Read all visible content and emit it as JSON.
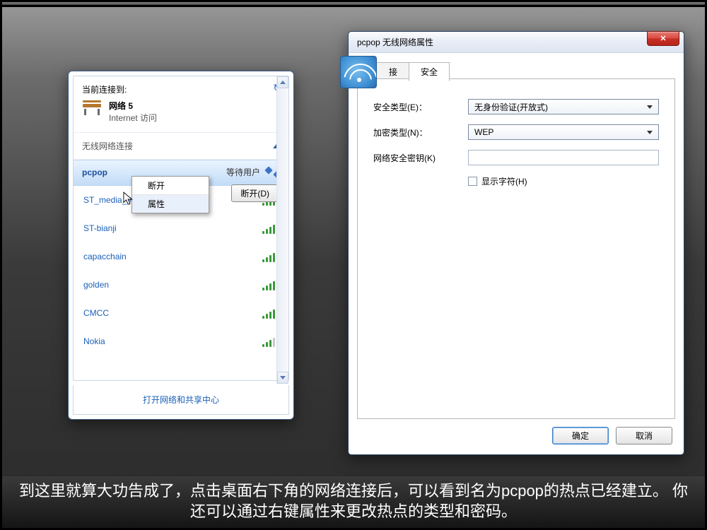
{
  "flyout": {
    "header_label": "当前连接到:",
    "current_network_name": "网络  5",
    "current_network_sub": "Internet 访问",
    "section_label": "无线网络连接",
    "connected": {
      "ssid": "pcpop",
      "status_suffix": "等待用户",
      "disconnect_btn": "断开(D)"
    },
    "context_menu": {
      "item_disconnect": "断开",
      "item_properties": "属性"
    },
    "networks": [
      {
        "ssid": "ST_media_9F",
        "bars": 5
      },
      {
        "ssid": "ST-bianji",
        "bars": 4
      },
      {
        "ssid": "capacchain",
        "bars": 4
      },
      {
        "ssid": "golden",
        "bars": 4
      },
      {
        "ssid": "CMCC",
        "bars": 5
      },
      {
        "ssid": "Nokia",
        "bars": 3
      }
    ],
    "footer_link": "打开网络和共享中心"
  },
  "dialog": {
    "title": "pcpop 无线网络属性",
    "tab_connection": "接",
    "tab_connection_full": "连接",
    "tab_security": "安全",
    "security_type_label": "安全类型(E)：",
    "security_type_value": "无身份验证(开放式)",
    "encryption_label": "加密类型(N)：",
    "encryption_value": "WEP",
    "key_label": "网络安全密钥(K)",
    "show_chars_label": "显示字符(H)",
    "ok": "确定",
    "cancel": "取消"
  },
  "caption": "到这里就算大功告成了，点击桌面右下角的网络连接后，可以看到名为pcpop的热点已经建立。 你还可以通过右键属性来更改热点的类型和密码。"
}
